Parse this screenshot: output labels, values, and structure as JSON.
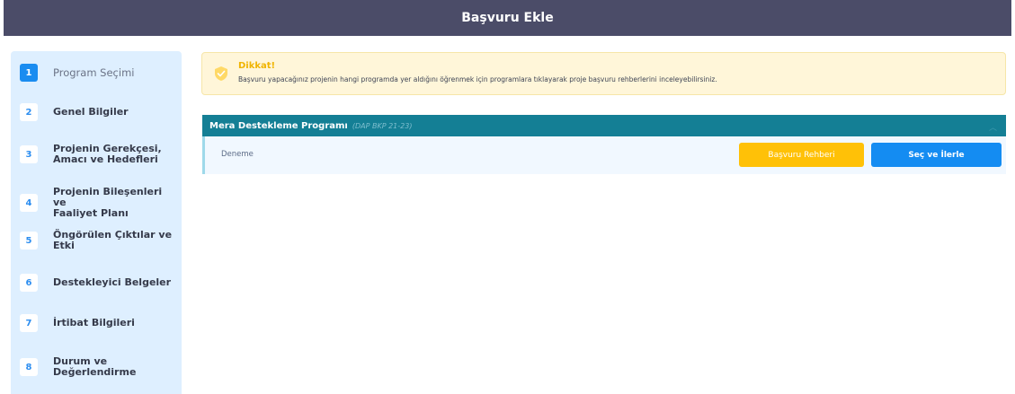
{
  "header": {
    "title": "Başvuru Ekle"
  },
  "sidebar": {
    "steps": [
      {
        "num": "1",
        "label": "Program Seçimi"
      },
      {
        "num": "2",
        "label": "Genel Bilgiler"
      },
      {
        "num": "3",
        "label": "Projenin Gerekçesi,\nAmacı ve Hedefleri"
      },
      {
        "num": "4",
        "label": "Projenin Bileşenleri ve\nFaaliyet Planı"
      },
      {
        "num": "5",
        "label": "Öngörülen Çıktılar ve\nEtki"
      },
      {
        "num": "6",
        "label": "Destekleyici Belgeler"
      },
      {
        "num": "7",
        "label": "İrtibat Bilgileri"
      },
      {
        "num": "8",
        "label": "Durum ve\nDeğerlendirme"
      }
    ]
  },
  "alert": {
    "title": "Dikkat!",
    "text": "Başvuru yapacağınız projenin hangi programda yer aldığını öğrenmek için programlara tıklayarak proje başvuru rehberlerini inceleyebilirsiniz.",
    "icon": "shield-check-icon"
  },
  "program": {
    "name": "Mera Destekleme Programı",
    "code": "(DAP BKP 21-23)",
    "item": "Deneme",
    "guide_button": "Başvuru Rehberi",
    "select_button": "Seç ve İlerle"
  },
  "colors": {
    "header": "#4b4c68",
    "sidebar": "#deefff",
    "program_bar": "#147f95",
    "warning": "#ffc107",
    "primary": "#148cf2"
  }
}
